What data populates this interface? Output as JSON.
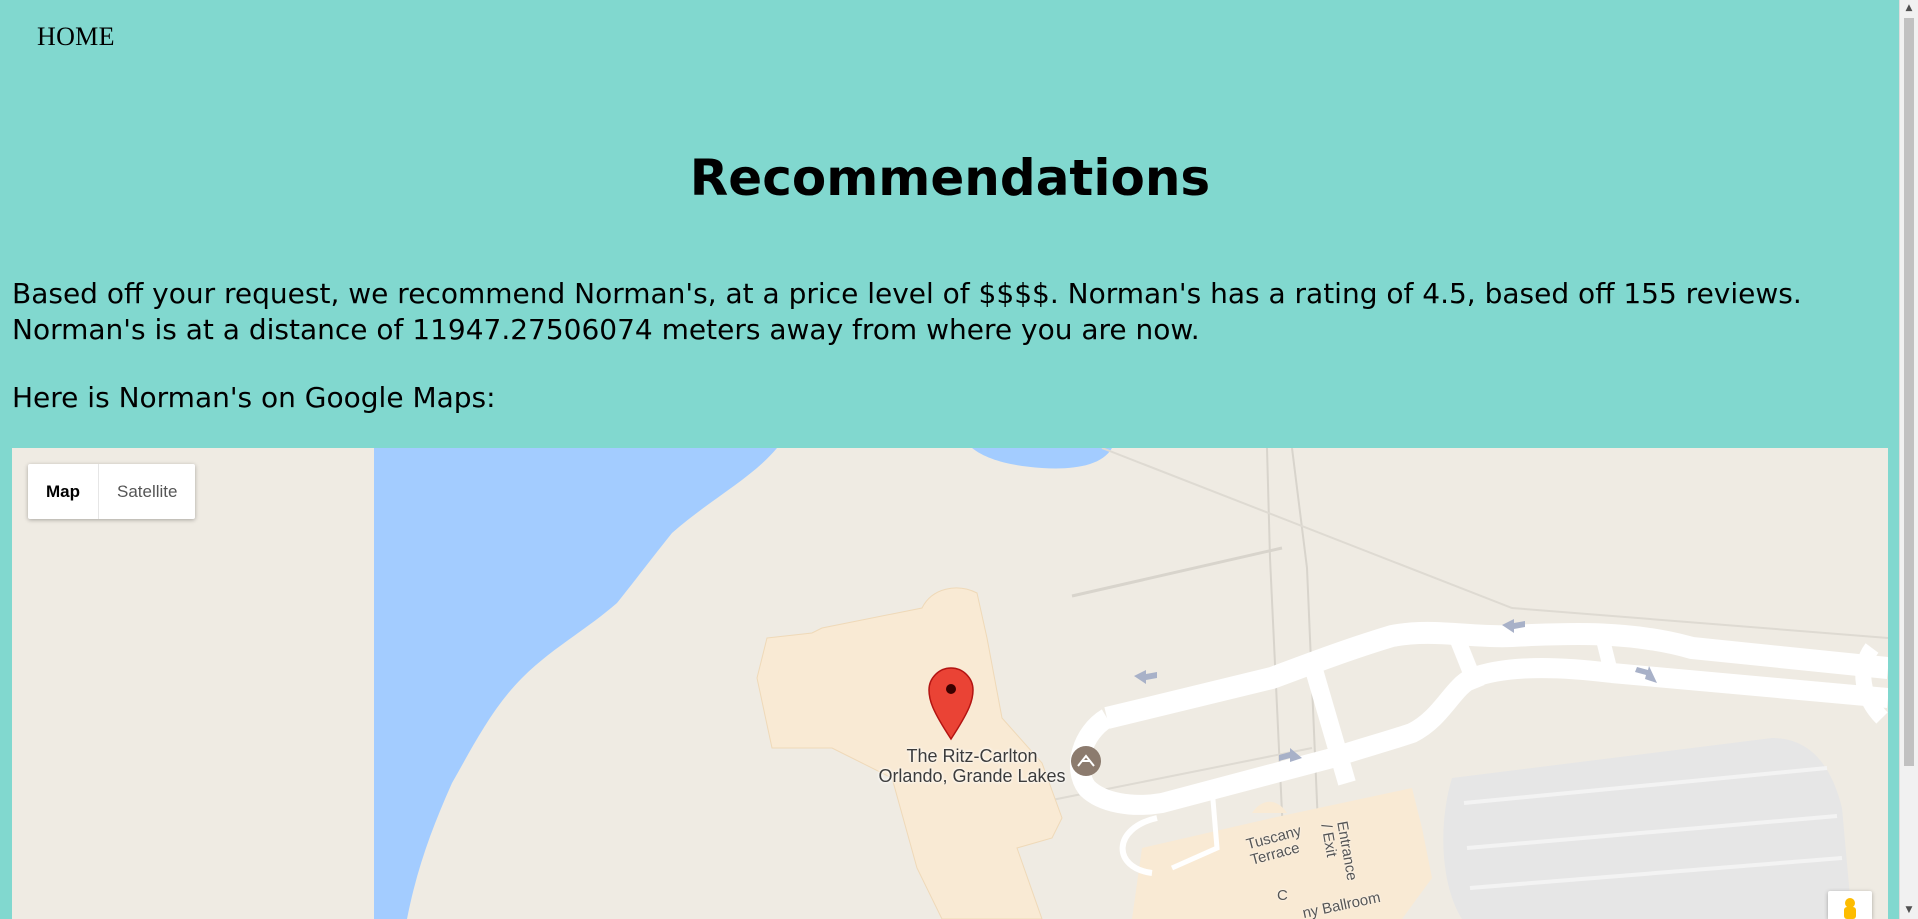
{
  "nav": {
    "home_label": "HOME"
  },
  "page": {
    "title": "Recommendations",
    "recommendation_text": "Based off your request, we recommend Norman's, at a price level of $$$$. Norman's has a rating of 4.5, based off 155 reviews. Norman's is at a distance of 11947.27506074 meters away from where you are now.",
    "maps_intro": "Here is Norman's on Google Maps:"
  },
  "map": {
    "type_buttons": [
      {
        "label": "Map",
        "selected": true
      },
      {
        "label": "Satellite",
        "selected": false
      }
    ],
    "poi_name_line1": "The Ritz-Carlton",
    "poi_name_line2": "Orlando, Grande Lakes",
    "label_tuscany_line1": "Tuscany",
    "label_tuscany_line2": "Terrace",
    "label_entrance_line1": "Entrance",
    "label_entrance_line2": "/ Exit",
    "label_c": "C",
    "label_ballroom": "ny Ballroom",
    "icons": [
      "map-marker-icon",
      "pool-icon",
      "pegman-icon",
      "one-way-arrow-icon"
    ],
    "colors": {
      "water": "#a3ccff",
      "land": "#efebe3",
      "building": "#f9ead4",
      "road": "#ffffff",
      "parking": "#e6e6e6",
      "marker": "#ea4335",
      "page_background": "#81d8cf"
    }
  }
}
